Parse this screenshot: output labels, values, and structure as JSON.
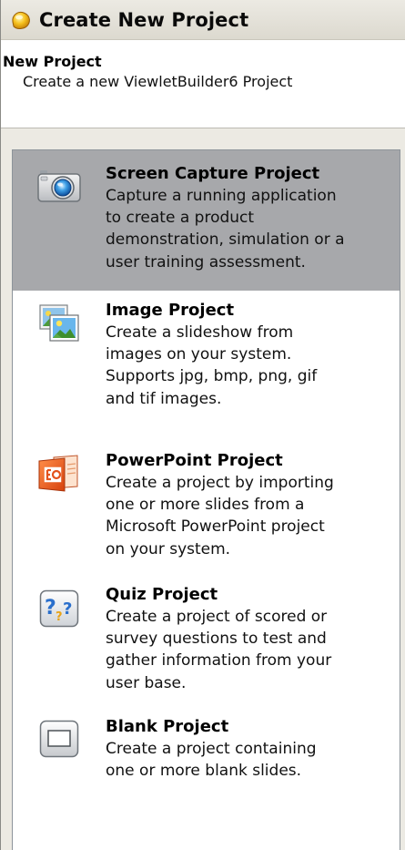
{
  "window": {
    "title": "Create New Project",
    "title_icon": "viewletbuilder-app-icon"
  },
  "header": {
    "title": "New Project",
    "subtitle": "Create a new ViewletBuilder6 Project"
  },
  "projects": [
    {
      "name": "Screen Capture Project",
      "lines": [
        "Capture a running application",
        "to create a product",
        "demonstration, simulation or a",
        "user training assessment."
      ],
      "icon": "camera-icon",
      "selected": true
    },
    {
      "name": "Image Project",
      "lines": [
        "Create a slideshow from",
        "images on your system.",
        "Supports jpg, bmp, png, gif",
        "and tif images."
      ],
      "icon": "images-icon",
      "selected": false
    },
    {
      "name": "PowerPoint Project",
      "lines": [
        "Create a project by importing",
        "one or more slides from a",
        "Microsoft PowerPoint project",
        "on your system."
      ],
      "icon": "powerpoint-icon",
      "selected": false
    },
    {
      "name": "Quiz Project",
      "lines": [
        "Create a project of scored or",
        "survey questions to test and",
        "gather information from your",
        "user base."
      ],
      "icon": "quiz-icon",
      "selected": false
    },
    {
      "name": "Blank Project",
      "lines": [
        "Create a project containing",
        "one or more blank slides."
      ],
      "icon": "blank-slide-icon",
      "selected": false
    }
  ],
  "colors": {
    "selection": "#a7a8ab",
    "panel": "#eceae3",
    "list_border": "#8d949a"
  }
}
